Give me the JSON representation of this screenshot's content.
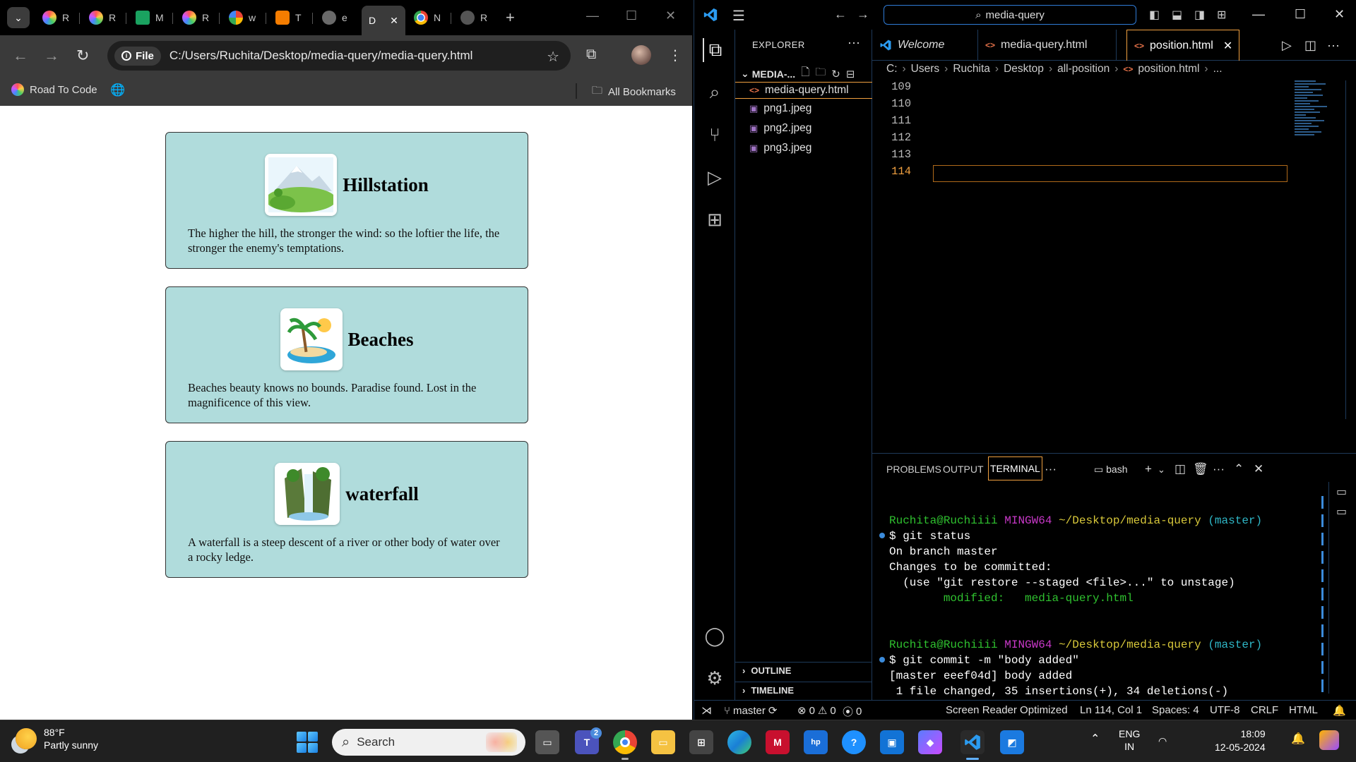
{
  "browser": {
    "tabs": [
      {
        "letter": "R",
        "icon": "hexagon-colorful-icon"
      },
      {
        "letter": "R",
        "icon": "hexagon-colorful-icon"
      },
      {
        "letter": "M",
        "icon": "green-doc-icon"
      },
      {
        "letter": "R",
        "icon": "hexagon-colorful-icon"
      },
      {
        "letter": "w",
        "icon": "google-icon"
      },
      {
        "letter": "T",
        "icon": "blogger-icon"
      },
      {
        "letter": "e",
        "icon": "globe-icon"
      },
      {
        "letter": "D",
        "icon": "none",
        "active": true
      },
      {
        "letter": "N",
        "icon": "chrome-icon"
      },
      {
        "letter": "R",
        "icon": "github-icon"
      }
    ],
    "file_chip": "File",
    "url": "C:/Users/Ruchita/Desktop/media-query/media-query.html",
    "bookmarks": {
      "item1": "Road To Code",
      "all": "All Bookmarks"
    }
  },
  "page": {
    "cards": [
      {
        "title": "Hillstation",
        "text": "The higher the hill, the stronger the wind: so the loftier the life, the stronger the enemy's temptations.",
        "image": "mountain-landscape-image"
      },
      {
        "title": "Beaches",
        "text": "Beaches beauty knows no bounds. Paradise found. Lost in the magnificence of this view.",
        "image": "beach-palm-image"
      },
      {
        "title": "waterfall",
        "text": "A waterfall is a steep descent of a river or other body of water over a rocky ledge.",
        "image": "waterfall-image"
      }
    ]
  },
  "vscode": {
    "command_center": "media-query",
    "explorer_title": "EXPLORER",
    "folder": "MEDIA-...",
    "files": [
      {
        "name": "media-query.html",
        "type": "html",
        "active": true
      },
      {
        "name": "png1.jpeg",
        "type": "image"
      },
      {
        "name": "png2.jpeg",
        "type": "image"
      },
      {
        "name": "png3.jpeg",
        "type": "image"
      }
    ],
    "outline": "OUTLINE",
    "timeline": "TIMELINE",
    "editor_tabs": [
      {
        "label": "Welcome",
        "active": false
      },
      {
        "label": "media-query.html",
        "active": false
      },
      {
        "label": "position.html",
        "active": true
      }
    ],
    "breadcrumbs": [
      "C:",
      "Users",
      "Ruchita",
      "Desktop",
      "all-position",
      "position.html",
      "..."
    ],
    "line_numbers": [
      "109",
      "110",
      "111",
      "112",
      "113",
      "114"
    ],
    "panel_tabs": [
      "PROBLEMS",
      "OUTPUT",
      "TERMINAL"
    ],
    "shell": "bash",
    "terminal": {
      "p1_user": "Ruchita@Ruchiiii",
      "p1_env": "MINGW64",
      "p1_path": "~/Desktop/media-query",
      "p1_branch": "(master)",
      "cmd1": "$ git status",
      "out1": "On branch master",
      "out2": "Changes to be committed:",
      "out3": "  (use \"git restore --staged <file>...\" to unstage)",
      "out4_label": "        modified:",
      "out4_file": "   media-query.html",
      "p2_user": "Ruchita@Ruchiiii",
      "p2_env": "MINGW64",
      "p2_path": "~/Desktop/media-query",
      "p2_branch": "(master)",
      "cmd2": "$ git commit -m \"body added\"",
      "out5": "[master eeef04d] body added",
      "out6": " 1 file changed, 35 insertions(+), 34 deletions(-)"
    },
    "status": {
      "branch": "master",
      "errors": "0",
      "warnings": "0",
      "ports": "0",
      "screen_reader": "Screen Reader Optimized",
      "position": "Ln 114, Col 1",
      "spaces": "Spaces: 4",
      "encoding": "UTF-8",
      "eol": "CRLF",
      "language": "HTML"
    }
  },
  "taskbar": {
    "temp": "88°F",
    "weather": "Partly sunny",
    "search": "Search",
    "teams_badge": "2",
    "lang1": "ENG",
    "lang2": "IN",
    "time": "18:09",
    "date": "12-05-2024"
  },
  "colors": {
    "card_bg": "#b0dcdc",
    "vscode_accent": "#f0a040",
    "terminal_green": "#2fc12f"
  }
}
